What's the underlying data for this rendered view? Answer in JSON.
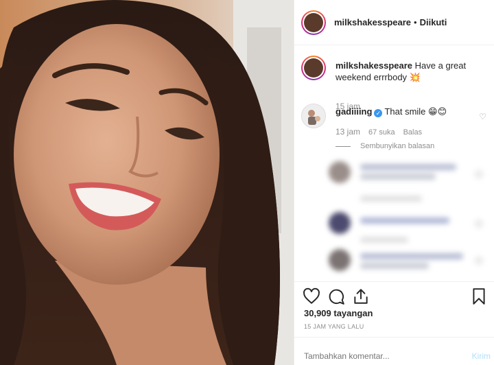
{
  "post": {
    "username": "milkshakesspeare",
    "separator": "•",
    "follow_status": "Diikuti",
    "caption": "Have a great weekend errrbody 💥",
    "caption_time": "15 jam"
  },
  "comments": [
    {
      "username": "gadiiiing",
      "verified": true,
      "text": "That smile 😁😊",
      "time": "13 jam",
      "likes": "67 suka",
      "reply_label": "Balas",
      "hide_replies_label": "Sembunyikan balasan"
    }
  ],
  "actions": {
    "icons": [
      "heart-icon",
      "comment-icon",
      "share-icon",
      "bookmark-icon"
    ],
    "views": "30,909 tayangan",
    "posted_ago": "15 JAM YANG LALU"
  },
  "comment_box": {
    "placeholder": "Tambahkan komentar...",
    "post_label": "Kirim"
  },
  "colors": {
    "accent": "#3897f0",
    "muted": "#8e8e8e",
    "border": "#efefef"
  }
}
